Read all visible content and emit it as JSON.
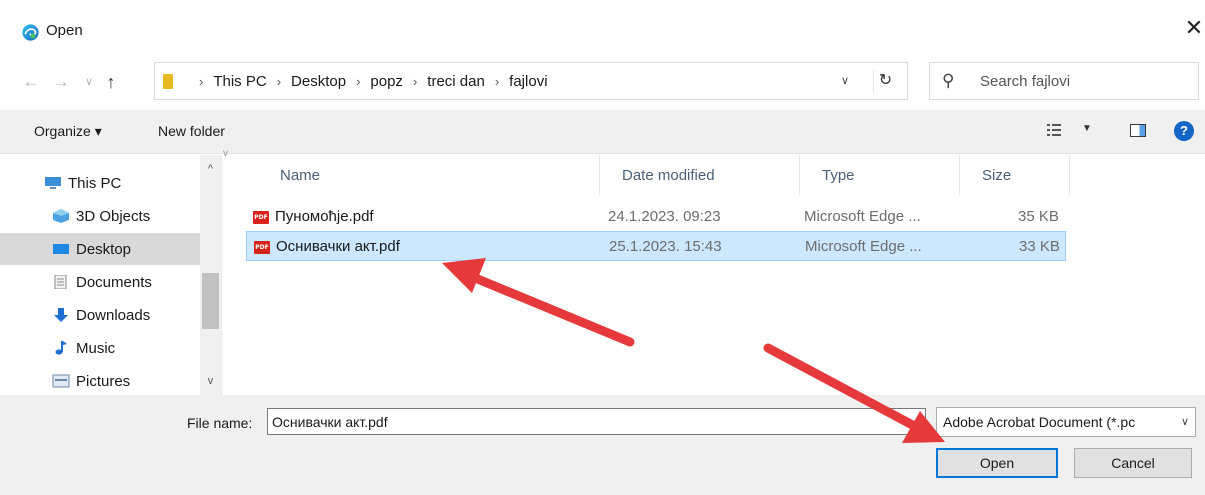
{
  "window": {
    "title": "Open",
    "close_glyph": "✕"
  },
  "navigation": {
    "back_glyph": "←",
    "forward_glyph": "→",
    "recent_glyph": "∨",
    "up_glyph": "↑"
  },
  "address": {
    "crumbs": [
      "This PC",
      "Desktop",
      "popz",
      "treci dan",
      "fajlovi"
    ],
    "separator": "›",
    "dropdown_glyph": "∨",
    "refresh_glyph": "↻"
  },
  "search": {
    "placeholder": "Search fajlovi"
  },
  "toolbar": {
    "organize_label": "Organize ▾",
    "new_folder_label": "New folder",
    "view_dropdown_glyph": "▼",
    "help_glyph": "?"
  },
  "sidebar": {
    "items": [
      {
        "label": "This PC",
        "icon": "computer-icon"
      },
      {
        "label": "3D Objects",
        "icon": "cube-icon"
      },
      {
        "label": "Desktop",
        "icon": "desktop-icon",
        "selected": true
      },
      {
        "label": "Documents",
        "icon": "document-icon"
      },
      {
        "label": "Downloads",
        "icon": "download-icon"
      },
      {
        "label": "Music",
        "icon": "music-icon"
      },
      {
        "label": "Pictures",
        "icon": "picture-icon"
      }
    ],
    "scroll_up_glyph": "^",
    "scroll_down_glyph": "v"
  },
  "files": {
    "columns": [
      "Name",
      "Date modified",
      "Type",
      "Size"
    ],
    "sort_glyph": "v",
    "rows": [
      {
        "name": "Пуномоћје.pdf",
        "date": "24.1.2023. 09:23",
        "type": "Microsoft Edge ...",
        "size": "35 KB",
        "selected": false
      },
      {
        "name": "Оснивачки акт.pdf",
        "date": "25.1.2023. 15:43",
        "type": "Microsoft Edge ...",
        "size": "33 KB",
        "selected": true
      }
    ],
    "icon": "pdf-icon",
    "icon_text": "PDF"
  },
  "footer": {
    "file_name_label": "File name:",
    "file_name_value": "Оснивачки акт.pdf",
    "file_type_value": "Adobe Acrobat Document (*.pc",
    "file_type_caret": "∨",
    "open_label": "Open",
    "cancel_label": "Cancel"
  },
  "colors": {
    "accent": "#0078d7",
    "selection": "#cce8ff",
    "arrow": "#e5393b"
  }
}
